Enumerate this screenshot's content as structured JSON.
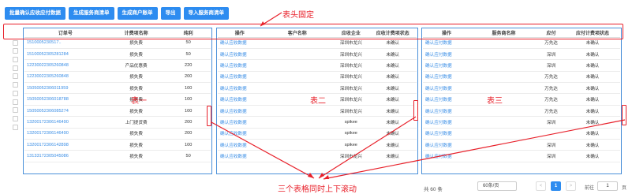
{
  "toolbar": {
    "buttons": [
      "批量确认应收应付数据",
      "生成服务商清单",
      "生成商户账单",
      "导出",
      "导入服务商清单"
    ]
  },
  "annotations": {
    "header_fixed": "表头固定",
    "sync_scroll": "三个表格同时上下滚动",
    "table1": "表一",
    "table2": "表二",
    "table3": "表三",
    "color": "#e8202a"
  },
  "table1": {
    "headers": [
      "订单号",
      "计费项名称",
      "纯利"
    ],
    "rows": [
      [
        "1510005230517..",
        "损失费",
        "50"
      ],
      [
        "15100052305281284",
        "损失费",
        "50"
      ],
      [
        "12230022305260848",
        "产品优惠费",
        "220"
      ],
      [
        "12230022305260848",
        "损失费",
        "200"
      ],
      [
        "15050052306011959",
        "损失费",
        "100"
      ],
      [
        "15050052306018788",
        "损失费",
        "100"
      ],
      [
        "15050052306085274",
        "损失费",
        "100"
      ],
      [
        "13200172306146490",
        "上门提货费",
        "200"
      ],
      [
        "13200172306146490",
        "损失费",
        "200"
      ],
      [
        "13200172306142898",
        "损失费",
        "100"
      ],
      [
        "13133172305045086",
        "损失费",
        "50"
      ]
    ]
  },
  "table2": {
    "headers": [
      "操作",
      "客户名称",
      "应收企业",
      "应收计费项状态"
    ],
    "rows": [
      [
        "确认应收数据",
        "",
        "深圳市龙兴",
        "未确认"
      ],
      [
        "确认应收数据",
        "",
        "深圳市龙兴",
        "未确认"
      ],
      [
        "确认应收数据",
        "",
        "深圳市龙兴",
        "未确认"
      ],
      [
        "确认应收数据",
        "",
        "深圳市龙兴",
        "未确认"
      ],
      [
        "确认应收数据",
        "",
        "深圳市龙兴",
        "未确认"
      ],
      [
        "确认应收数据",
        "",
        "深圳市龙兴",
        "未确认"
      ],
      [
        "确认应收数据",
        "",
        "深圳市龙兴",
        "未确认"
      ],
      [
        "确认应收数据",
        "",
        "spikee",
        "未确认"
      ],
      [
        "确认应收数据",
        "",
        "spikee",
        "未确认"
      ],
      [
        "确认应收数据",
        "",
        "spikee",
        "未确认"
      ],
      [
        "确认应收数据",
        "",
        "深圳市龙兴",
        "未确认"
      ]
    ]
  },
  "table3": {
    "headers": [
      "操作",
      "服务商名称",
      "应付",
      "应付计费项状态"
    ],
    "rows": [
      [
        "确认应付数据",
        "",
        "万先达",
        "未确认"
      ],
      [
        "确认应付数据",
        "",
        "深圳",
        "未确认"
      ],
      [
        "确认应付数据",
        "",
        "深圳",
        "未确认"
      ],
      [
        "确认应付数据",
        "",
        "万先达",
        "未确认"
      ],
      [
        "确认应付数据",
        "",
        "万先达",
        "未确认"
      ],
      [
        "确认应付数据",
        "",
        "万先达",
        "未确认"
      ],
      [
        "确认应付数据",
        "",
        "万先达",
        "未确认"
      ],
      [
        "确认应付数据",
        "",
        "深圳",
        "未确认"
      ],
      [
        "确认应付数据",
        "",
        "",
        "未确认"
      ],
      [
        "确认应付数据",
        "",
        "深圳",
        "未确认"
      ],
      [
        "确认应付数据",
        "",
        "深圳",
        "未确认"
      ]
    ]
  },
  "pagination": {
    "total": "共 60 条",
    "page_size": "60条/页",
    "prev": "<",
    "current": "1",
    "next": ">",
    "goto_label": "前往",
    "goto_value": "1",
    "page_unit": "页"
  }
}
